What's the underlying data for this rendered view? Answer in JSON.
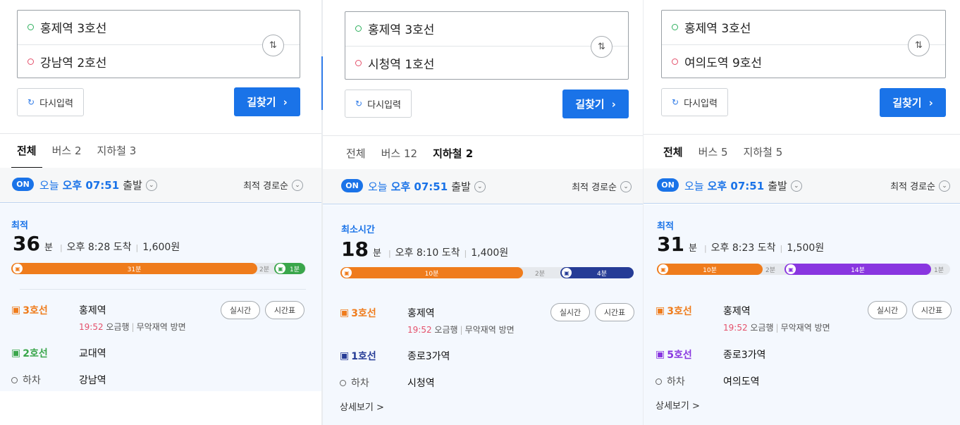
{
  "colors": {
    "line2": "#3aa64b",
    "line3": "#ef7c1c",
    "line1": "#263c96",
    "line5": "#8936e0",
    "accent": "#1a73e8"
  },
  "common": {
    "swap_icon": "⇅",
    "reset_label": "다시입력",
    "find_label": "길찾기",
    "on_badge": "ON",
    "depart_prefix": "오늘",
    "depart_time": "오후 07:51",
    "depart_suffix": "출발",
    "sort_label": "최적 경로순",
    "realtime_label": "실시간",
    "timetable_label": "시간표",
    "alight_label": "하차",
    "detail_label": "상세보기 >"
  },
  "panel1": {
    "origin": "홍제역 3호선",
    "destination": "강남역 2호선",
    "tabs": [
      {
        "label": "전체"
      },
      {
        "label": "버스 2"
      },
      {
        "label": "지하철 3"
      }
    ],
    "badge": "최적",
    "duration": "36",
    "unit": "분",
    "arrival": "오후 8:28 도착",
    "fare": "1,600원",
    "bar": {
      "seg1_label": "31분",
      "gap_label": "2분",
      "seg2_label": "1분",
      "seg1_fraction": 0.86,
      "seg2_fraction": 0.1
    },
    "steps": [
      {
        "line": "3호선",
        "station": "홍제역",
        "time": "19:52",
        "direction": "오금행",
        "toward": "무악재역 방면"
      },
      {
        "line": "2호선",
        "station": "교대역"
      },
      {
        "line": "하차",
        "station": "강남역"
      }
    ]
  },
  "panel2": {
    "origin": "홍제역 3호선",
    "destination": "시청역 1호선",
    "tabs": [
      {
        "label": "전체"
      },
      {
        "label": "버스 12"
      },
      {
        "label": "지하철 2"
      }
    ],
    "badge": "최소시간",
    "duration": "18",
    "unit": "분",
    "arrival": "오후 8:10 도착",
    "fare": "1,400원",
    "bar": {
      "seg1_label": "10분",
      "gap_label": "2분",
      "seg2_label": "4분",
      "seg1_fraction": 0.6,
      "seg2_fraction": 0.25
    },
    "steps": [
      {
        "line": "3호선",
        "station": "홍제역",
        "time": "19:52",
        "direction": "오금행",
        "toward": "무악재역 방면"
      },
      {
        "line": "1호선",
        "station": "종로3가역"
      },
      {
        "line": "하차",
        "station": "시청역"
      }
    ]
  },
  "panel3": {
    "origin": "홍제역 3호선",
    "destination": "여의도역 9호선",
    "tabs": [
      {
        "label": "전체"
      },
      {
        "label": "버스 5"
      },
      {
        "label": "지하철 5"
      }
    ],
    "badge": "최적",
    "duration": "31",
    "unit": "분",
    "arrival": "오후 8:23 도착",
    "fare": "1,500원",
    "bar": {
      "seg1_label": "10분",
      "gap_label": "2분",
      "seg2_label": "14분",
      "end_label": "1분",
      "seg1_fraction": 0.36,
      "seg2_fraction": 0.5
    },
    "steps": [
      {
        "line": "3호선",
        "station": "홍제역",
        "time": "19:52",
        "direction": "오금행",
        "toward": "무악재역 방면"
      },
      {
        "line": "5호선",
        "station": "종로3가역"
      },
      {
        "line": "하차",
        "station": "여의도역"
      }
    ]
  }
}
